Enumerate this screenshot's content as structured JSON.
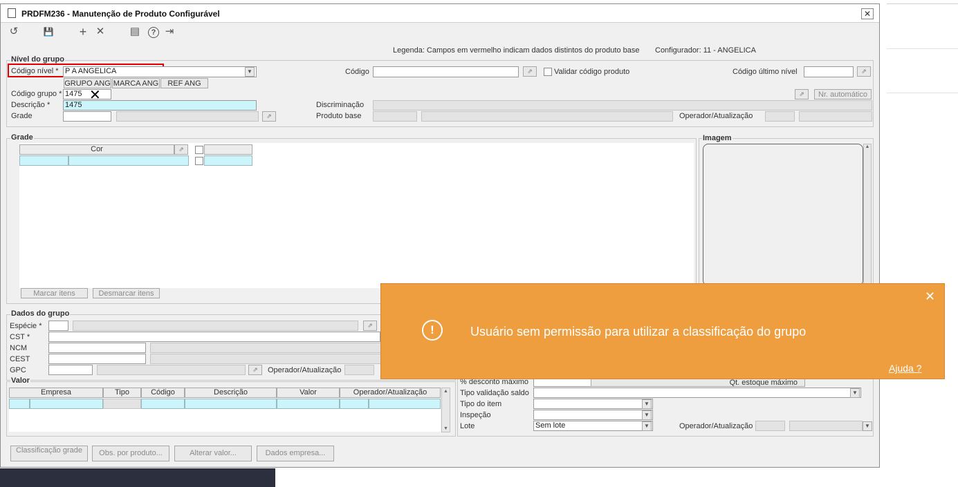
{
  "window": {
    "title": "PRDFM236 - Manutenção de Produto Configurável"
  },
  "legend": {
    "text": "Legenda: Campos em vermelho indicam dados distintos do produto base",
    "configurator": "Configurador: 11 - ANGELICA"
  },
  "nivel": {
    "group_title": "Nível do grupo",
    "codigo_nivel_label": "Código nível *",
    "codigo_nivel_value": "P A  ANGELICA",
    "sub_tabs": [
      "GRUPO ANG",
      "MARCA ANG",
      "REF ANG"
    ],
    "codigo_grupo_label": "Código grupo *",
    "codigo_grupo_value": "1475",
    "descricao_label": "Descrição *",
    "descricao_value": "1475",
    "grade_label": "Grade",
    "codigo_label": "Código",
    "validar_label": "Validar código produto",
    "codigo_ultimo_label": "Código último nível",
    "nr_auto_label": "Nr. automático",
    "discriminacao_label": "Discriminação",
    "produto_base_label": "Produto base",
    "operador_label": "Operador/Atualização"
  },
  "grade": {
    "group_title": "Grade",
    "col_cor": "Cor",
    "marcar_label": "Marcar itens",
    "desmarcar_label": "Desmarcar itens"
  },
  "imagem": {
    "group_title": "Imagem"
  },
  "dados": {
    "group_title": "Dados do grupo",
    "especie_label": "Espécie *",
    "cst_label": "CST *",
    "ncm_label": "NCM",
    "cest_label": "CEST",
    "gpc_label": "GPC",
    "operador_label": "Operador/Atualização"
  },
  "valor": {
    "group_title": "Valor",
    "columns": [
      "Empresa",
      "Tipo",
      "Código",
      "Descrição",
      "Valor",
      "Operador/Atualização"
    ]
  },
  "right": {
    "desconto_label": "% desconto máximo",
    "qt_estoque_label": "Qt. estoque máximo",
    "tipo_validacao_label": "Tipo validação saldo",
    "tipo_item_label": "Tipo do item",
    "inspecao_label": "Inspeção",
    "lote_label": "Lote",
    "lote_value": "Sem lote",
    "operador_label": "Operador/Atualização"
  },
  "footer": {
    "classificacao_label": "Classificação grade",
    "obs_label": "Obs. por produto...",
    "alterar_label": "Alterar valor...",
    "dados_empresa_label": "Dados empresa..."
  },
  "toast": {
    "message": "Usuário sem permissão para utilizar a classificação do grupo",
    "help_label": "Ajuda ?",
    "close_glyph": "✕",
    "icon_glyph": "!"
  },
  "toolbar": {
    "refresh_glyph": "↺",
    "save_glyph": "💾",
    "add_glyph": "+",
    "delete_glyph": "✕",
    "calendar_glyph": "▤",
    "help_glyph": "?",
    "exit_glyph": "⇥"
  },
  "colors": {
    "toast_bg": "#ef9e3f",
    "highlight_red": "#e00000",
    "cyan_field": "#ccf4fb"
  }
}
